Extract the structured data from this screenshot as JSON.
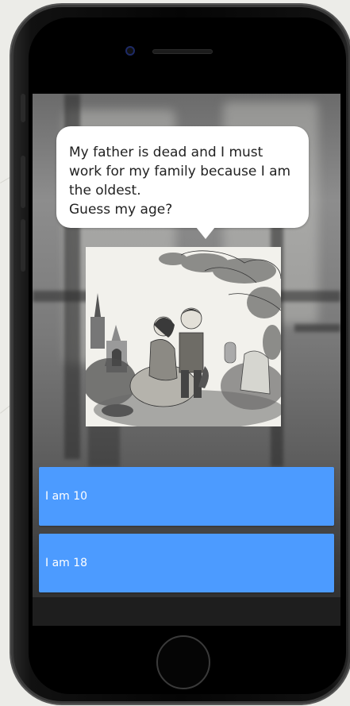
{
  "phone": {
    "icons": {
      "camera": "front-camera-icon",
      "speaker": "earpiece-speaker-icon",
      "home": "home-button-icon"
    }
  },
  "game": {
    "speech_bubble": {
      "text": "My father is dead and I must\nwork for my family because I am\nthe oldest.\nGuess my age?"
    },
    "illustration": {
      "icon": "victorian-engraving-two-children-churchyard"
    },
    "answers": [
      {
        "label": "I am 10"
      },
      {
        "label": "I am 18"
      }
    ],
    "colors": {
      "answer_background": "#4c9bff",
      "answer_text": "#ffffff",
      "bubble_background": "#ffffff",
      "bubble_text": "#222222"
    }
  }
}
